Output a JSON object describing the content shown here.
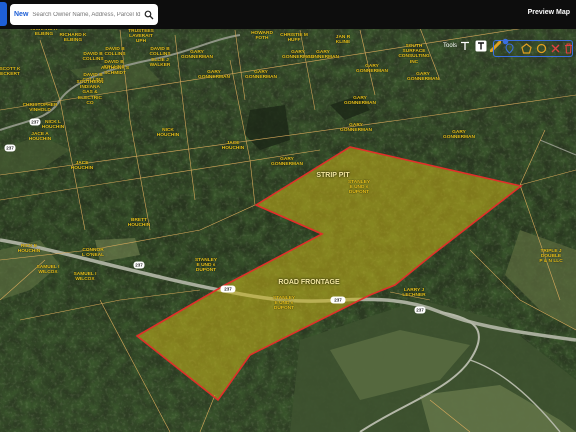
{
  "search": {
    "mode_label": "New",
    "placeholder": "Search Owner Name, Address, Parcel Id"
  },
  "header": {
    "preview_label": "Preview Map"
  },
  "toolbar": {
    "label": "Tools",
    "active_color": "#3b6fe0",
    "draw_color": "#e0a020",
    "delete_color": "#e04040",
    "badge": "●"
  },
  "colors": {
    "parcel_line": "#d9aa5c",
    "highlight_fill": "#c9b31a",
    "highlight_border": "#e0302a",
    "owner_label": "#e8c21c",
    "road": "#a8ad9c"
  },
  "highlighted_labels": {
    "strip_pit": "STRIP PIT",
    "road_frontage": "ROAD FRONTAGE"
  },
  "owners": [
    {
      "name": "RICHARD K\nELBING"
    },
    {
      "name": "RICHARD K\nELBING"
    },
    {
      "name": "DAVID B\nCOLLINS"
    },
    {
      "name": "DAVID B\nCOLLINS"
    },
    {
      "name": "TRUSTEES\nLAVERAIT\nUPH"
    },
    {
      "name": "DAVID B\nCOLLINS"
    },
    {
      "name": "DAVID B\nCOLLINS"
    },
    {
      "name": "ANTHONY S\nSCHMIDT"
    },
    {
      "name": "DAVID B\nCOLLINS"
    },
    {
      "name": "ELLIE J\nWALKER"
    },
    {
      "name": "SCOTT K\nECKERT"
    },
    {
      "name": "SOUTHERN\nINDIANA\nGAS &\nELECTRIC\nCO"
    },
    {
      "name": "GARY\nGONNERMAN"
    },
    {
      "name": "GARY\nGONNERMAN"
    },
    {
      "name": "GARY\nGONNERMAN"
    },
    {
      "name": "GARY\nGONNERMAN"
    },
    {
      "name": "GARY\nGONNERMAN"
    },
    {
      "name": "GARY\nGONNERMAN"
    },
    {
      "name": "GARY\nGONNERMAN"
    },
    {
      "name": "GARY\nGONNERMAN"
    },
    {
      "name": "JAN R\nKLINE"
    },
    {
      "name": "SOUTH\nSURFACE\nCONSULTING\nINC"
    },
    {
      "name": "CHRISTOPHER\nVINHOLD"
    },
    {
      "name": "NICK L\nHOUCHIN"
    },
    {
      "name": "JACE A\nHOUCHIN"
    },
    {
      "name": "NICK\nHOUCHIN"
    },
    {
      "name": "JACE\nHOUCHIN"
    },
    {
      "name": "JACE\nHOUCHIN"
    },
    {
      "name": "GARY\nGONNERMAN"
    },
    {
      "name": "GARY\nGONNERMAN"
    },
    {
      "name": "GARY\nGONNERMAN"
    },
    {
      "name": "BRETT\nHOUCHIN"
    },
    {
      "name": "RICK E\nHOUCHIN"
    },
    {
      "name": "CONNOR\nL O'NEAL"
    },
    {
      "name": "SAMUEL I\nWILCOX"
    },
    {
      "name": "SAMUEL I\nWILCOX"
    },
    {
      "name": "STANLEY\nE UND s\nDUPONT"
    },
    {
      "name": "STANLEY\nE UND s\nDUPONT"
    },
    {
      "name": "STANLEY\nE UND s\nDUPONT"
    },
    {
      "name": "LARRY J\nLECHNER"
    },
    {
      "name": "TRIPLE J\nDOUBLE\nP & N LLC"
    },
    {
      "name": "HOWARD\nFOTH"
    },
    {
      "name": "CHRISTIE M\nHUFF"
    }
  ],
  "roads": [
    {
      "label": "237"
    },
    {
      "label": "237"
    },
    {
      "label": "237"
    },
    {
      "label": "237"
    },
    {
      "label": "237"
    },
    {
      "label": "237"
    }
  ]
}
